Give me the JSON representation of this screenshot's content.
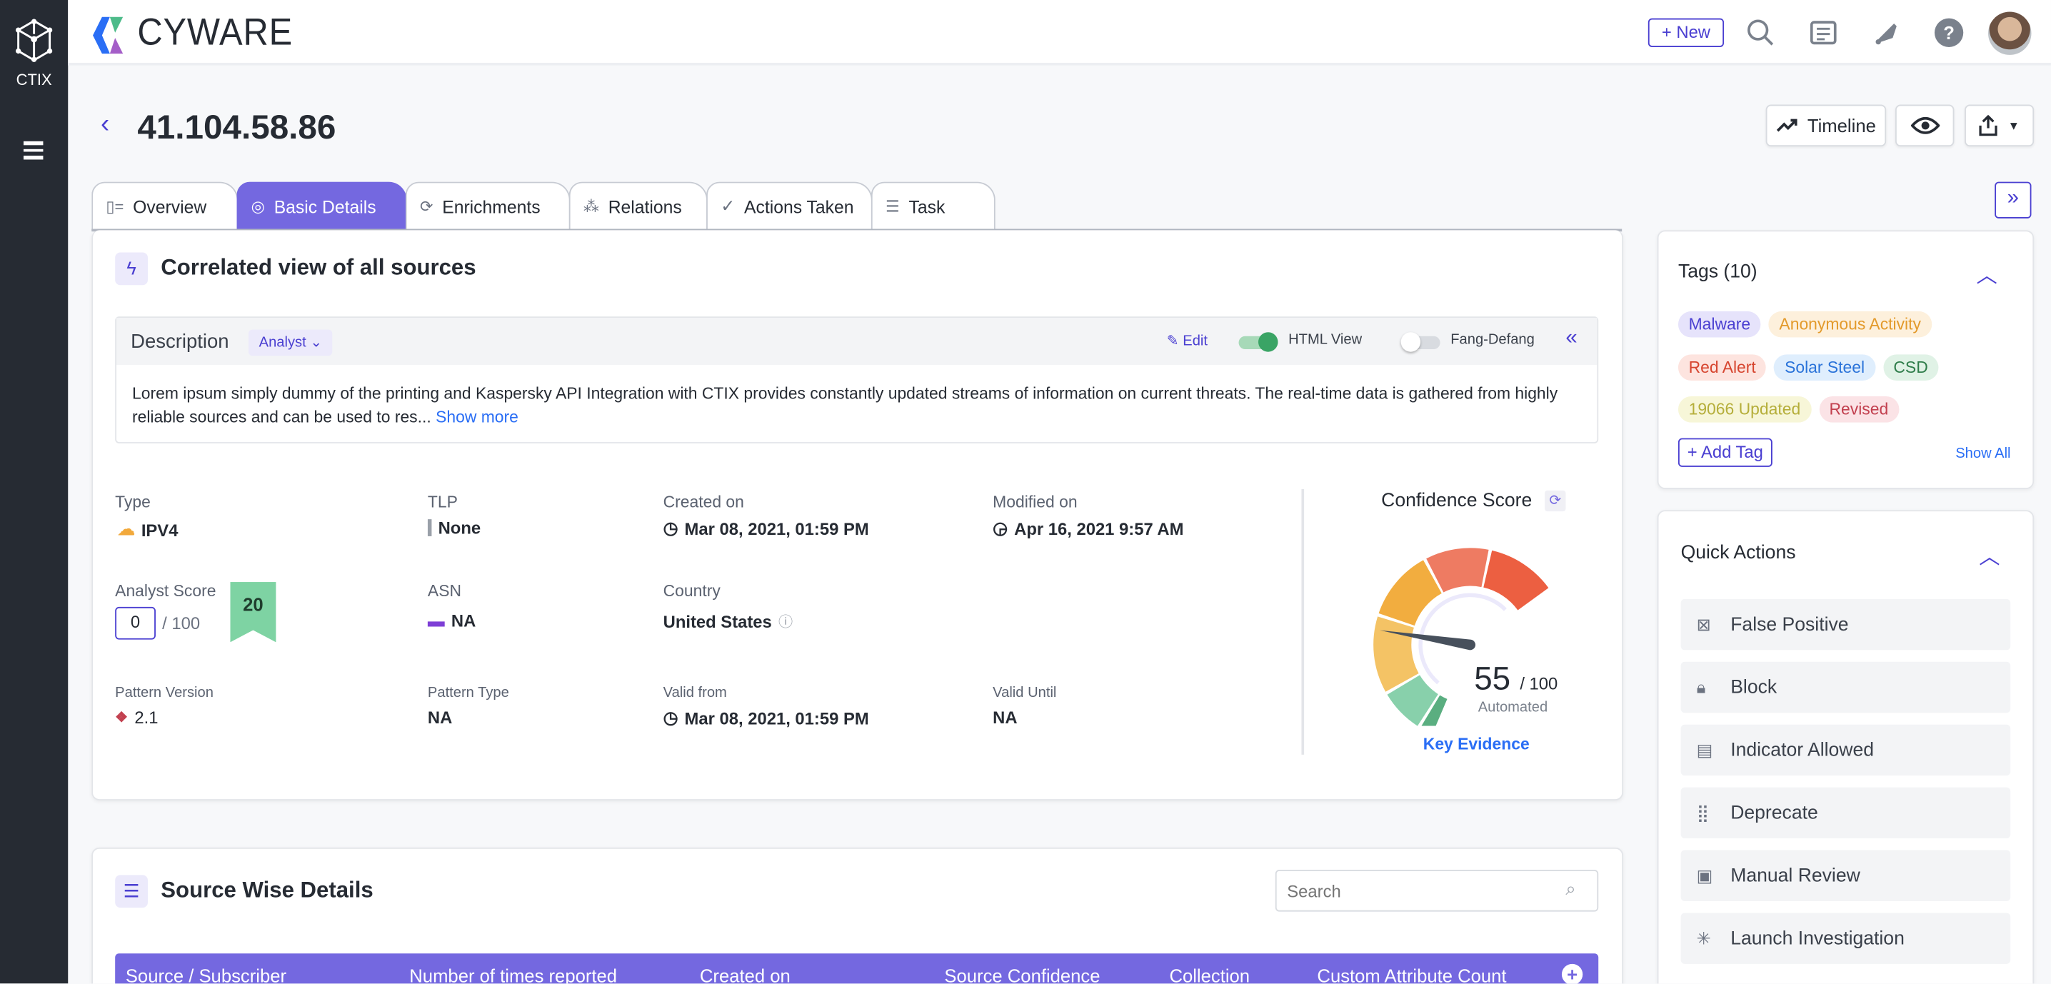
{
  "sidebar": {
    "app_label": "CTIX"
  },
  "header": {
    "brand": "CYWARE",
    "new_label": "+ New"
  },
  "page": {
    "title": "41.104.58.86",
    "timeline_label": "Timeline"
  },
  "tabs": [
    {
      "label": "Overview"
    },
    {
      "label": "Basic Details"
    },
    {
      "label": "Enrichments"
    },
    {
      "label": "Relations"
    },
    {
      "label": "Actions Taken"
    },
    {
      "label": "Task"
    }
  ],
  "correlated": {
    "heading": "Correlated view of all sources",
    "description": {
      "label": "Description",
      "source": "Analyst",
      "edit": "Edit",
      "html_view": "HTML View",
      "fang": "Fang-Defang",
      "text": "Lorem ipsum simply dummy of the printing and Kaspersky API Integration with CTIX provides constantly updated streams of information on current threats. The real-time data is gathered from highly reliable sources and can be used to res...",
      "show_more": "Show more"
    },
    "fields": {
      "type": {
        "label": "Type",
        "value": "IPV4"
      },
      "tlp": {
        "label": "TLP",
        "value": "None"
      },
      "created": {
        "label": "Created on",
        "value": "Mar 08, 2021, 01:59 PM"
      },
      "modified": {
        "label": "Modified on",
        "value": "Apr 16, 2021 9:57 AM"
      },
      "analyst_score": {
        "label": "Analyst Score",
        "value": "0",
        "max": "/ 100",
        "badge": "20"
      },
      "asn": {
        "label": "ASN",
        "value": "NA"
      },
      "country": {
        "label": "Country",
        "value": "United States"
      },
      "pattern_version": {
        "label": "Pattern Version",
        "value": "2.1"
      },
      "pattern_type": {
        "label": "Pattern Type",
        "value": "NA"
      },
      "valid_from": {
        "label": "Valid from",
        "value": "Mar 08, 2021, 01:59 PM"
      },
      "valid_until": {
        "label": "Valid Until",
        "value": "NA"
      }
    },
    "confidence": {
      "label": "Confidence Score",
      "score": 55,
      "score_text": "55",
      "max": "/ 100",
      "mode": "Automated",
      "link": "Key Evidence"
    }
  },
  "source_wise": {
    "heading": "Source Wise Details",
    "search_placeholder": "Search",
    "columns": [
      "Source / Subscriber",
      "Number of times reported",
      "Created on",
      "Source Confidence",
      "Collection",
      "Custom Attribute Count"
    ]
  },
  "tags": {
    "heading": "Tags (10)",
    "add": "+ Add Tag",
    "show_all": "Show All",
    "items": [
      {
        "label": "Malware",
        "bg": "#e6e3fb",
        "fg": "#4a3fd1"
      },
      {
        "label": "Anonymous Activity",
        "bg": "#fdf0dc",
        "fg": "#e39a2b"
      },
      {
        "label": "Red Alert",
        "bg": "#fde4df",
        "fg": "#d6452f"
      },
      {
        "label": "Solar Steel",
        "bg": "#dfeefd",
        "fg": "#2a73d9"
      },
      {
        "label": "CSD",
        "bg": "#e0f2e6",
        "fg": "#2f7d4a"
      },
      {
        "label": "19066 Updated",
        "bg": "#f7f6d8",
        "fg": "#b5ae3a"
      },
      {
        "label": "Revised",
        "bg": "#fbe3e6",
        "fg": "#c2404f"
      }
    ]
  },
  "quick_actions": {
    "heading": "Quick Actions",
    "items": [
      {
        "label": "False Positive",
        "icon": "false-positive-icon"
      },
      {
        "label": "Block",
        "icon": "lock-icon"
      },
      {
        "label": "Indicator Allowed",
        "icon": "allowlist-icon"
      },
      {
        "label": "Deprecate",
        "icon": "deprecate-icon"
      },
      {
        "label": "Manual Review",
        "icon": "review-icon"
      },
      {
        "label": "Launch Investigation",
        "icon": "investigation-icon"
      }
    ]
  }
}
